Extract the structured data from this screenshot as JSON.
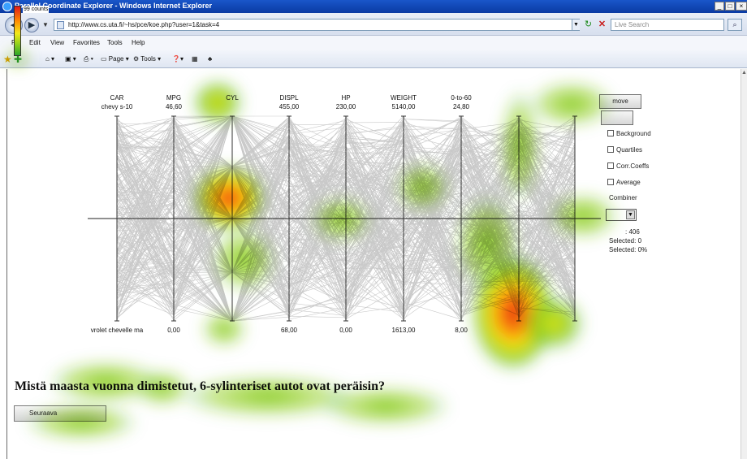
{
  "window": {
    "title": "Parallel Coordinate Explorer - Windows Internet Explorer",
    "controls": [
      "_",
      "□",
      "×"
    ]
  },
  "addressbar": {
    "url": "http://www.cs.uta.fi/~hs/pce/koe.php?user=1&task=4",
    "search_placeholder": "Live Search"
  },
  "menu": [
    "Edit",
    "View",
    "Favorites",
    "Tools",
    "Help"
  ],
  "commandbar": {
    "page": "Page",
    "tools": "Tools"
  },
  "heatmap": {
    "legend_label": "99 counts",
    "max_count": 99,
    "colors": [
      "#e11a1a",
      "#ff8c00",
      "#f3e81a",
      "#9ad31a",
      "#2aa62a"
    ]
  },
  "pcp": {
    "axes": [
      {
        "name": "CAR",
        "top": "chevy s-10",
        "bottom": "vrolet chevelle ma"
      },
      {
        "name": "MPG",
        "top": "46,60",
        "bottom": "0,00"
      },
      {
        "name": "CYL",
        "top": "",
        "bottom": ""
      },
      {
        "name": "DISPL",
        "top": "455,00",
        "bottom": "68,00"
      },
      {
        "name": "HP",
        "top": "230,00",
        "bottom": "0,00"
      },
      {
        "name": "WEIGHT",
        "top": "5140,00",
        "bottom": "1613,00"
      },
      {
        "name": "0-to-60",
        "top": "24,80",
        "bottom": "8,00"
      },
      {
        "name": "",
        "top": "",
        "bottom": ""
      },
      {
        "name": "",
        "top": "",
        "bottom": ""
      }
    ]
  },
  "side_panel": {
    "btn1": "move",
    "options": [
      "Background",
      "Quartiles",
      "Corr.Coeffs",
      "Average"
    ],
    "combiner_label": "Combiner",
    "total_suffix": ": 406",
    "selected": "Selected: 0",
    "selected_pct": "Selected: 0%"
  },
  "question": "Mistä maasta vuonna        dimistetut, 6-sylinteriset autot ovat peräisin?",
  "next_button": "Seuraava"
}
